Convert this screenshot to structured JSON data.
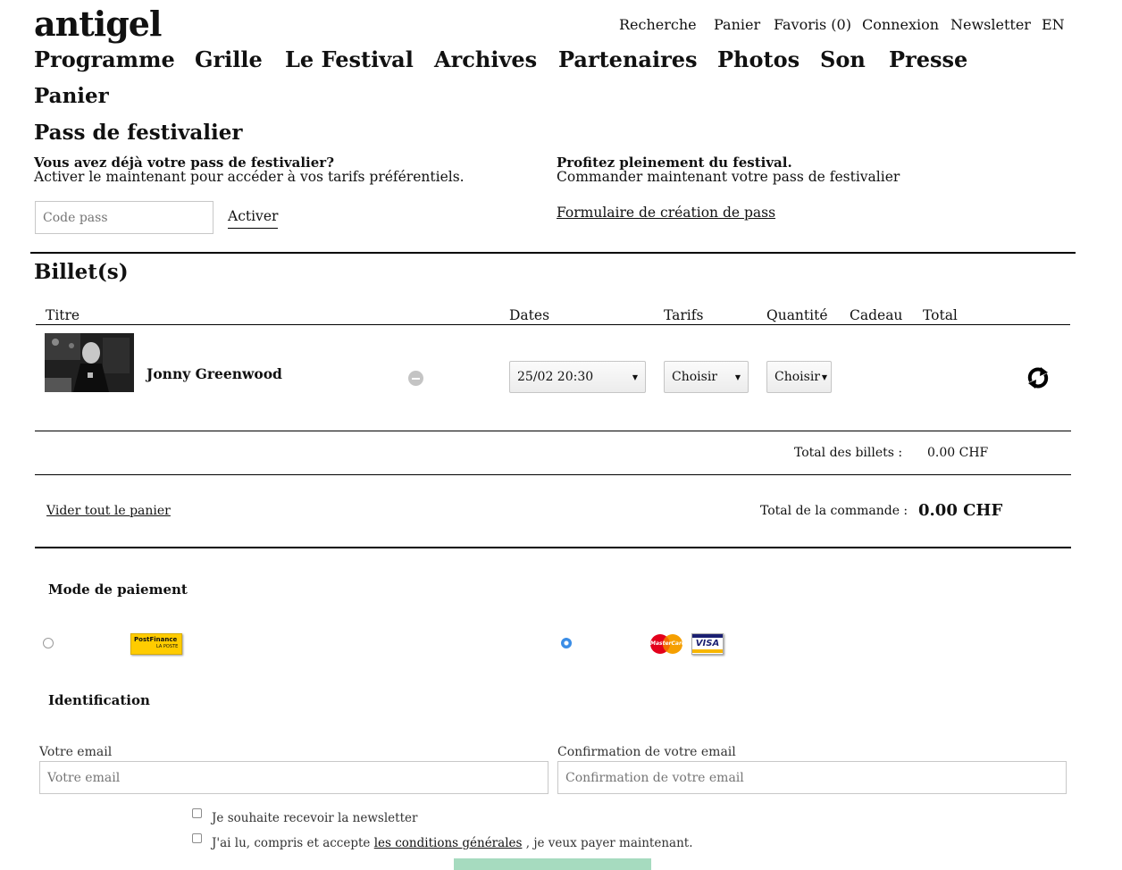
{
  "logo": "antigel",
  "top_nav": [
    "Recherche",
    "Panier",
    "Favoris (0)",
    "Connexion",
    "Newsletter",
    "EN"
  ],
  "main_nav": [
    "Programme",
    "Grille",
    "Le Festival",
    "Archives",
    "Partenaires",
    "Photos",
    "Son",
    "Presse"
  ],
  "page_title": "Panier",
  "pass": {
    "title": "Pass de festivalier",
    "left_heading": "Vous avez déjà votre pass de festivalier?",
    "left_text": "Activer le maintenant pour accéder à vos tarifs préférentiels.",
    "code_placeholder": "Code pass",
    "activate_label": "Activer",
    "right_heading": "Profitez pleinement du festival.",
    "right_text": "Commander maintenant votre pass de festivalier",
    "form_link": "Formulaire de création de pass"
  },
  "tickets": {
    "title": "Billet(s)",
    "columns": [
      "Titre",
      "Dates",
      "Tarifs",
      "Quantité",
      "Cadeau",
      "Total"
    ],
    "rows": [
      {
        "title": "Jonny Greenwood",
        "date": "25/02 20:30",
        "tarif": "Choisir",
        "quantite": "Choisir"
      }
    ],
    "total_label": "Total des billets :",
    "total_value": "0.00 CHF",
    "empty_cart": "Vider tout le panier",
    "order_total_label": "Total de la commande :",
    "order_total_value": "0.00 CHF"
  },
  "payment": {
    "title": "Mode de paiement",
    "postfinance_logo": "PostFinance",
    "postfinance_sub": "LA POSTE",
    "mastercard_logo": "MasterCard",
    "visa_logo": "VISA",
    "selected": "card"
  },
  "identification": {
    "title": "Identification",
    "email_label": "Votre email",
    "email_placeholder": "Votre email",
    "confirm_label": "Confirmation de votre email",
    "confirm_placeholder": "Confirmation de votre email",
    "newsletter_text": "Je souhaite recevoir la newsletter",
    "terms_prefix": "J'ai lu, compris et accepte",
    "terms_link": "les conditions générales",
    "terms_suffix": ", je veux payer maintenant."
  },
  "colors": {
    "button_green": "#a6dbbf",
    "radio_blue": "#3b8de6",
    "postfinance_yellow": "#ffcc00"
  }
}
